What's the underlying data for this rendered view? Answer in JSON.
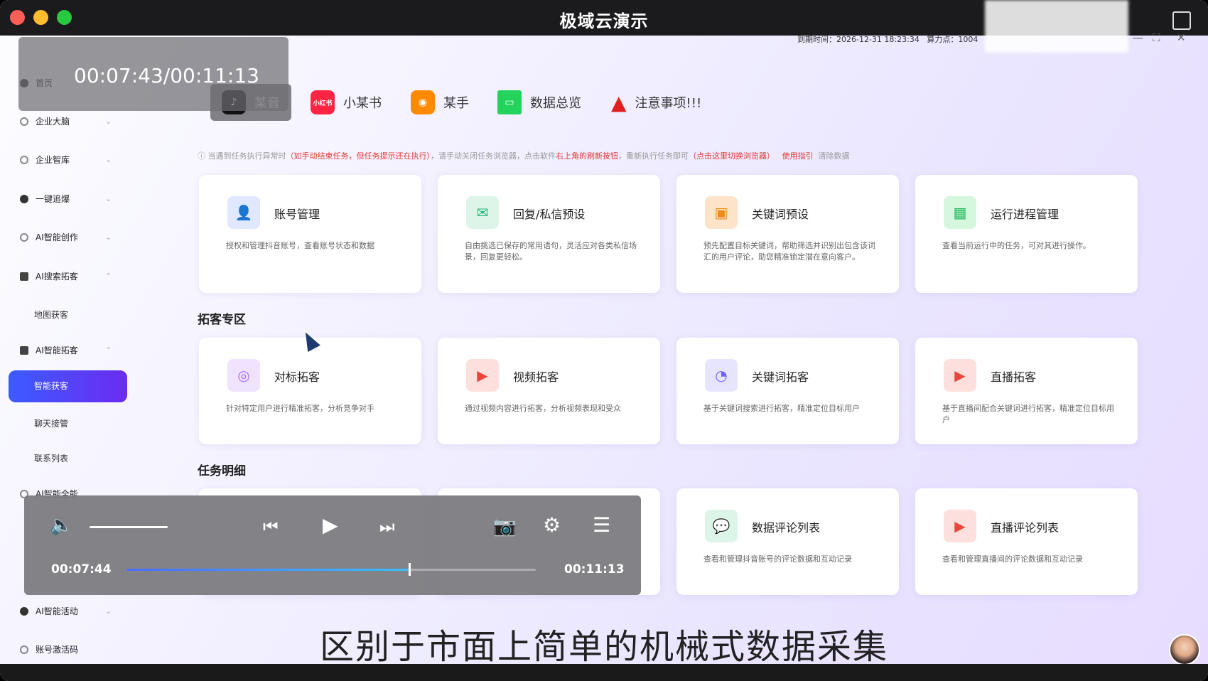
{
  "window": {
    "title": "极域云演示"
  },
  "status": {
    "expire": "到期时间：2026-12-31 18:23:34",
    "points": "算力点：1004"
  },
  "overlay": {
    "time": "00:07:43/00:11:13"
  },
  "sidebar": {
    "items": [
      {
        "label": "首页"
      },
      {
        "label": "企业大脑"
      },
      {
        "label": "企业智库"
      },
      {
        "label": "一键追爆"
      },
      {
        "label": "AI智能创作"
      },
      {
        "label": "AI搜索拓客"
      },
      {
        "label": "地图获客"
      },
      {
        "label": "AI智能拓客"
      },
      {
        "label": "智能获客"
      },
      {
        "label": "聊天接管"
      },
      {
        "label": "联系列表"
      },
      {
        "label": "AI智能全能"
      },
      {
        "label": "AI智能活动"
      },
      {
        "label": "账号激活码"
      }
    ]
  },
  "topnav": [
    {
      "label": "某音",
      "icon": "tiktok-icon"
    },
    {
      "label": "小某书",
      "icon": "xiaohongshu-icon"
    },
    {
      "label": "某手",
      "icon": "kuaishou-icon"
    },
    {
      "label": "数据总览",
      "icon": "monitor-icon"
    },
    {
      "label": "注意事项!!!",
      "icon": "warning-icon"
    }
  ],
  "notice": {
    "part1": "当遇到任务执行异常时",
    "part2": "（如手动结束任务，但任务提示还在执行）",
    "part3": "，请手动关闭任务浏览器，点击软件",
    "part4": "右上角的刷新按钮",
    "part5": "，重新执行任务即可",
    "part6": "（点击这里切换浏览器）",
    "link1": "使用指引",
    "link2": "清除数据"
  },
  "cards_top": [
    {
      "title": "账号管理",
      "desc": "授权和管理抖音账号，查看账号状态和数据",
      "icon": "user-icon",
      "color": "#4a7dff"
    },
    {
      "title": "回复/私信预设",
      "desc": "自由挑选已保存的常用语句，灵活应对各类私信场景，回复更轻松。",
      "icon": "mail-icon",
      "color": "#27b574"
    },
    {
      "title": "关键词预设",
      "desc": "预先配置目标关键词，帮助筛选并识别出包含该词汇的用户评论，助您精准锁定潜在意向客户。",
      "icon": "keyword-icon",
      "color": "#f08a1c"
    },
    {
      "title": "运行进程管理",
      "desc": "查看当前运行中的任务，可对其进行操作。",
      "icon": "process-icon",
      "color": "#1fb95a"
    }
  ],
  "sections": {
    "tuoke": "拓客专区",
    "tasks": "任务明细"
  },
  "cards_mid": [
    {
      "title": "对标拓客",
      "desc": "针对特定用户进行精准拓客，分析竞争对手",
      "icon": "target-icon",
      "color": "#a46bff"
    },
    {
      "title": "视频拓客",
      "desc": "通过视频内容进行拓客，分析视频表现和受众",
      "icon": "video-icon",
      "color": "#e8473c"
    },
    {
      "title": "关键词拓客",
      "desc": "基于关键词搜索进行拓客，精准定位目标用户",
      "icon": "radar-icon",
      "color": "#6a63ff"
    },
    {
      "title": "直播拓客",
      "desc": "基于直播间配合关键词进行拓客，精准定位目标用户",
      "icon": "live-icon",
      "color": "#e8473c"
    }
  ],
  "cards_bottom": [
    {
      "title": "数据评论列表",
      "desc": "查看和管理抖音账号的评论数据和互动记录",
      "icon": "comment-icon",
      "color": "#27b574"
    },
    {
      "title": "直播评论列表",
      "desc": "查看和管理直播间的评论数据和互动记录",
      "icon": "live-icon",
      "color": "#e8473c"
    }
  ],
  "player": {
    "current": "00:07:44",
    "total": "00:11:13",
    "progress": 0.69,
    "volume": 1.0
  },
  "subtitle": "区别于市面上简单的机械式数据采集"
}
